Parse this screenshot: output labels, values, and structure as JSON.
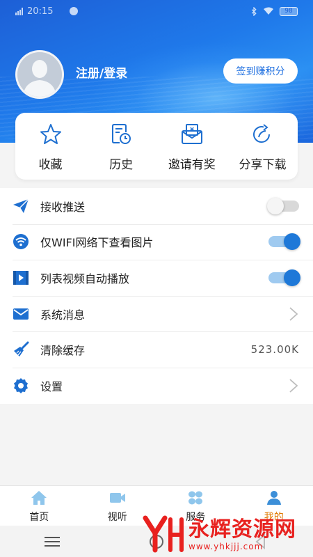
{
  "status_bar": {
    "time": "20:15",
    "battery": "98"
  },
  "profile": {
    "login_text": "注册/登录",
    "checkin_label": "签到赚积分"
  },
  "quick_actions": [
    {
      "label": "收藏",
      "icon": "star-icon"
    },
    {
      "label": "历史",
      "icon": "history-icon"
    },
    {
      "label": "邀请有奖",
      "icon": "invite-reward-icon"
    },
    {
      "label": "分享下载",
      "icon": "share-icon"
    }
  ],
  "settings": {
    "push": {
      "label": "接收推送",
      "icon": "paper-plane-icon",
      "enabled": false
    },
    "wifi_images": {
      "label": "仅WIFI网络下查看图片",
      "icon": "wifi-icon",
      "enabled": true
    },
    "autoplay": {
      "label": "列表视频自动播放",
      "icon": "video-icon",
      "enabled": true
    },
    "messages": {
      "label": "系统消息",
      "icon": "mail-icon"
    },
    "cache": {
      "label": "清除缓存",
      "icon": "broom-icon",
      "value": "523.00K"
    },
    "settings": {
      "label": "设置",
      "icon": "gear-icon"
    }
  },
  "bottom_nav": [
    {
      "label": "首页",
      "icon": "home-icon",
      "active": false
    },
    {
      "label": "视听",
      "icon": "camera-icon",
      "active": false
    },
    {
      "label": "服务",
      "icon": "services-icon",
      "active": false
    },
    {
      "label": "我的",
      "icon": "user-icon",
      "active": true
    }
  ],
  "watermark": {
    "name": "永辉资源网",
    "url": "www.yhkjjj.com"
  },
  "colors": {
    "primary": "#1e78d8",
    "header": "#1f79ea",
    "active_tab": "#e07a00",
    "watermark": "#e8211f"
  }
}
